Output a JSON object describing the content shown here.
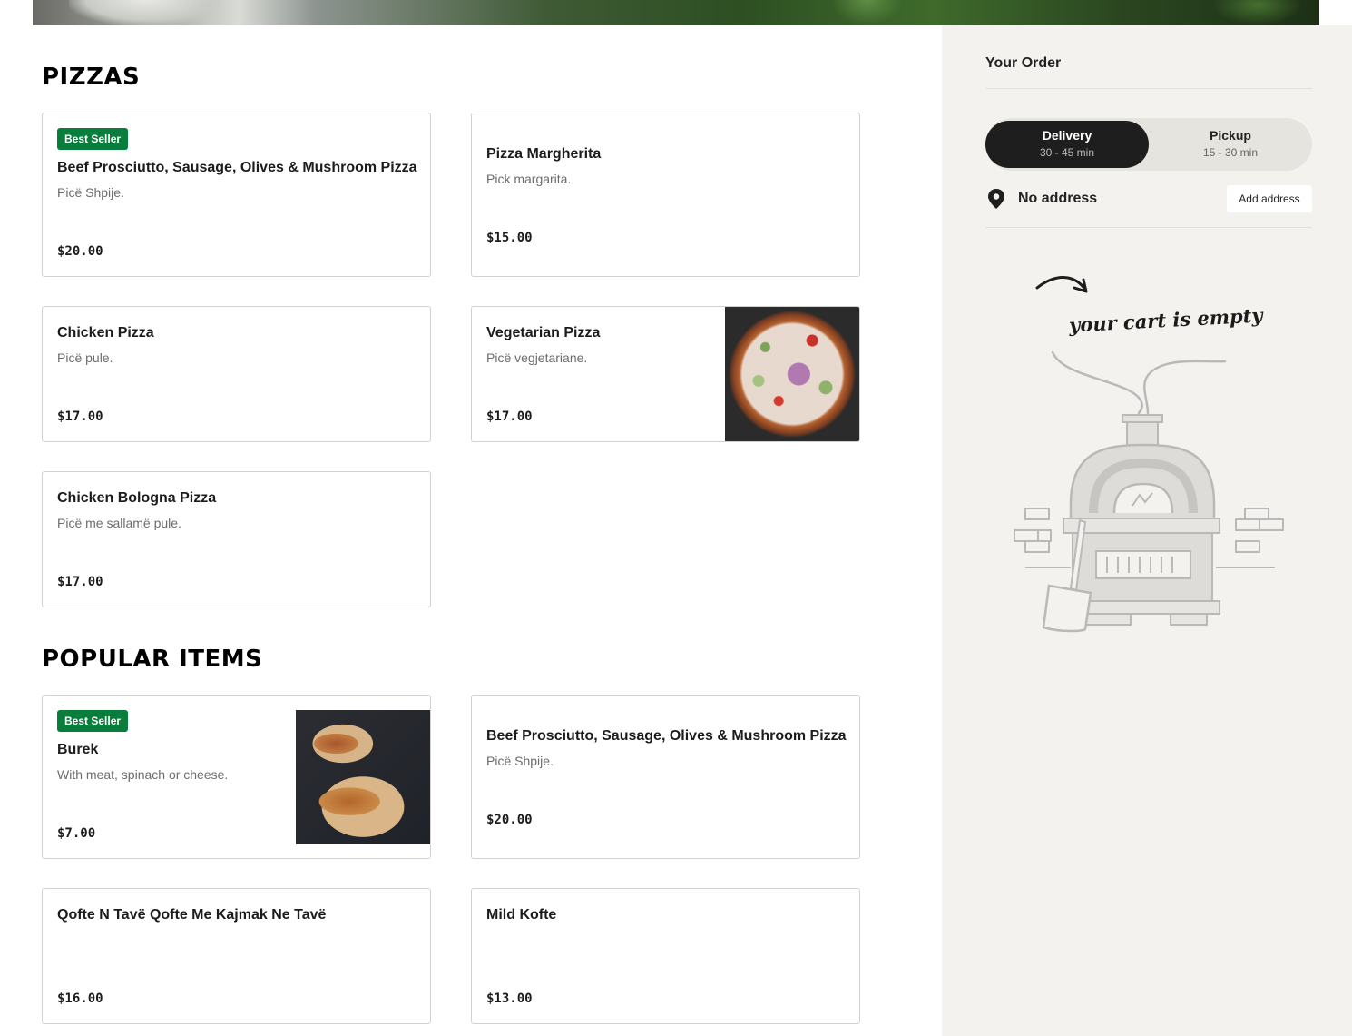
{
  "sections": [
    {
      "title": "PIZZAS",
      "items": [
        {
          "badge": "Best Seller",
          "name": "Beef Prosciutto, Sausage, Olives & Mushroom Pizza",
          "desc": "Picë Shpije.",
          "price": "$20.00"
        },
        {
          "name": "Pizza Margherita",
          "desc": "Pick margarita.",
          "price": "$15.00"
        },
        {
          "name": "Chicken Pizza",
          "desc": "Picë pule.",
          "price": "$17.00"
        },
        {
          "name": "Vegetarian Pizza",
          "desc": "Picë vegjetariane.",
          "price": "$17.00"
        },
        {
          "name": "Chicken Bologna Pizza",
          "desc": "Picë me sallamë pule.",
          "price": "$17.00"
        }
      ]
    },
    {
      "title": "POPULAR ITEMS",
      "items": [
        {
          "badge": "Best Seller",
          "name": "Burek",
          "desc": "With meat, spinach or cheese.",
          "price": "$7.00"
        },
        {
          "name": "Beef Prosciutto, Sausage, Olives & Mushroom Pizza",
          "desc": "Picë Shpije.",
          "price": "$20.00"
        },
        {
          "name": "Qofte N Tavë Qofte Me Kajmak Ne Tavë",
          "price": "$16.00"
        },
        {
          "name": "Mild Kofte",
          "price": "$13.00"
        }
      ]
    }
  ],
  "order": {
    "title": "Your Order",
    "delivery": {
      "label": "Delivery",
      "time": "30 - 45 min"
    },
    "pickup": {
      "label": "Pickup",
      "time": "15 - 30 min"
    },
    "address": "No address",
    "add_address": "Add address",
    "empty_text": "your cart is empty"
  },
  "colors": {
    "badge": "#097d3c",
    "sidebar_bg": "#f3f2ef",
    "toggle_active": "#1e1e1e"
  }
}
